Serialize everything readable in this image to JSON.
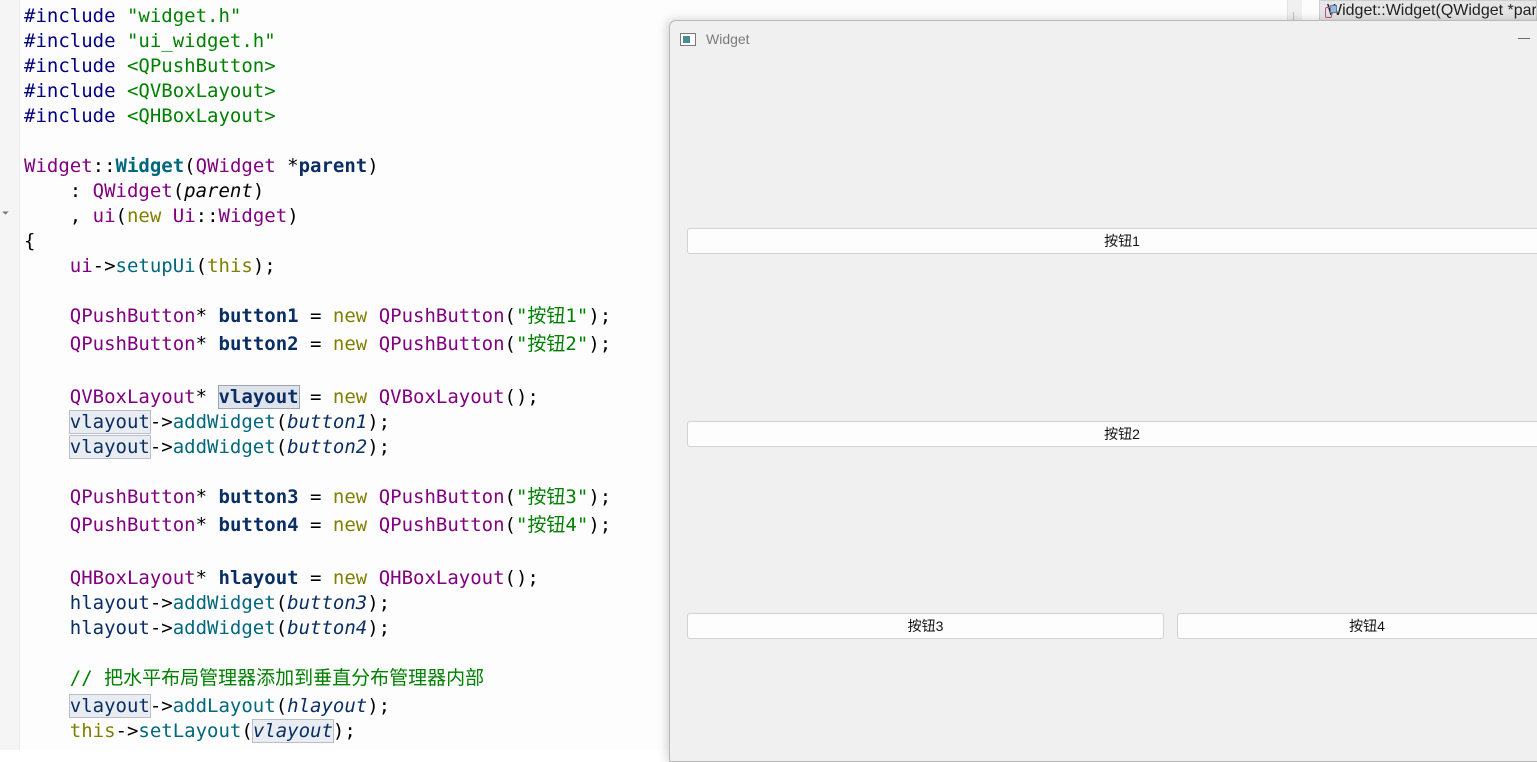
{
  "editor": {
    "func_combo": "Widget::Widget(QWidget *parent)",
    "fold_marker": "⏷",
    "lines": {
      "inc1_kw": "#include ",
      "inc1_file": "\"widget.h\"",
      "inc2_kw": "#include ",
      "inc2_file": "\"ui_widget.h\"",
      "inc3_kw": "#include ",
      "inc3_file": "<QPushButton>",
      "inc4_kw": "#include ",
      "inc4_file": "<QVBoxLayout>",
      "inc5_kw": "#include ",
      "inc5_file": "<QHBoxLayout>",
      "ctor_class": "Widget",
      "ctor_sep": "::",
      "ctor_name": "Widget",
      "ctor_open": "(",
      "ctor_type": "QWidget",
      "ctor_ptr": " *",
      "ctor_param": "parent",
      "ctor_close": ")",
      "init1_pre": "    : ",
      "init1_class": "QWidget",
      "init1_open": "(",
      "init1_arg": "parent",
      "init1_close": ")",
      "init2_pre": "    , ",
      "init2_member": "ui",
      "init2_open": "(",
      "init2_new": "new",
      "init2_sp": " ",
      "init2_ns": "Ui",
      "init2_sep": "::",
      "init2_cls": "Widget",
      "init2_close": ")",
      "brace": "{",
      "setup_indent": "    ",
      "setup_ui": "ui",
      "setup_arrow": "->",
      "setup_fn": "setupUi",
      "setup_open": "(",
      "setup_this": "this",
      "setup_close": ");",
      "b1_indent": "    ",
      "b1_type": "QPushButton",
      "b1_star": "* ",
      "b1_var": "button1",
      "b1_eq": " = ",
      "b1_new": "new",
      "b1_sp": " ",
      "b1_cls": "QPushButton",
      "b1_open": "(",
      "b1_str": "\"按钮1\"",
      "b1_close": ");",
      "b2_indent": "    ",
      "b2_type": "QPushButton",
      "b2_star": "* ",
      "b2_var": "button2",
      "b2_eq": " = ",
      "b2_new": "new",
      "b2_sp": " ",
      "b2_cls": "QPushButton",
      "b2_open": "(",
      "b2_str": "\"按钮2\"",
      "b2_close": ");",
      "vl_indent": "    ",
      "vl_type": "QVBoxLayout",
      "vl_star": "* ",
      "vl_var": "vlayout",
      "vl_eq": " = ",
      "vl_new": "new",
      "vl_sp": " ",
      "vl_cls": "QVBoxLayout",
      "vl_close": "();",
      "va1_indent": "    ",
      "va1_var": "vlayout",
      "va1_arrow": "->",
      "va1_fn": "addWidget",
      "va1_open": "(",
      "va1_arg": "button1",
      "va1_close": ");",
      "va2_indent": "    ",
      "va2_var": "vlayout",
      "va2_arrow": "->",
      "va2_fn": "addWidget",
      "va2_open": "(",
      "va2_arg": "button2",
      "va2_close": ");",
      "b3_indent": "    ",
      "b3_type": "QPushButton",
      "b3_star": "* ",
      "b3_var": "button3",
      "b3_eq": " = ",
      "b3_new": "new",
      "b3_sp": " ",
      "b3_cls": "QPushButton",
      "b3_open": "(",
      "b3_str": "\"按钮3\"",
      "b3_close": ");",
      "b4_indent": "    ",
      "b4_type": "QPushButton",
      "b4_star": "* ",
      "b4_var": "button4",
      "b4_eq": " = ",
      "b4_new": "new",
      "b4_sp": " ",
      "b4_cls": "QPushButton",
      "b4_open": "(",
      "b4_str": "\"按钮4\"",
      "b4_close": ");",
      "hl_indent": "    ",
      "hl_type": "QHBoxLayout",
      "hl_star": "* ",
      "hl_var": "hlayout",
      "hl_eq": " = ",
      "hl_new": "new",
      "hl_sp": " ",
      "hl_cls": "QHBoxLayout",
      "hl_close": "();",
      "ha1_indent": "    ",
      "ha1_var": "hlayout",
      "ha1_arrow": "->",
      "ha1_fn": "addWidget",
      "ha1_open": "(",
      "ha1_arg": "button3",
      "ha1_close": ");",
      "ha2_indent": "    ",
      "ha2_var": "hlayout",
      "ha2_arrow": "->",
      "ha2_fn": "addWidget",
      "ha2_open": "(",
      "ha2_arg": "button4",
      "ha2_close": ");",
      "comment_indent": "    ",
      "comment": "// 把水平布局管理器添加到垂直分布管理器内部",
      "al_indent": "    ",
      "al_var": "vlayout",
      "al_arrow": "->",
      "al_fn": "addLayout",
      "al_open": "(",
      "al_arg": "hlayout",
      "al_close": ");",
      "sl_indent": "    ",
      "sl_this": "this",
      "sl_arrow": "->",
      "sl_fn": "setLayout",
      "sl_open": "(",
      "sl_arg": "vlayout",
      "sl_close": ");"
    }
  },
  "window": {
    "title": "Widget",
    "buttons": {
      "button1": "按钮1",
      "button2": "按钮2",
      "button3": "按钮3",
      "button4": "按钮4"
    }
  }
}
